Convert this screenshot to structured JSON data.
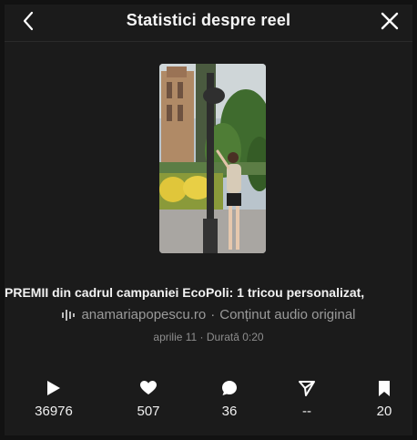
{
  "header": {
    "title": "Statistici despre reel",
    "back_icon": "chevron-left-icon",
    "close_icon": "close-icon"
  },
  "reel": {
    "caption": "PREMII din cadrul campaniei EcoPoli: 1 tricou personalizat,",
    "audio_source": "anamariapopescu.ro",
    "audio_separator": "·",
    "audio_label": "Conținut audio original",
    "meta": "aprilie 11 · Durată 0:20"
  },
  "stats": {
    "plays": "36976",
    "likes": "507",
    "comments": "36",
    "shares": "--",
    "saves": "20"
  },
  "colors": {
    "background": "#1b1b1b",
    "text": "#f5f5f5",
    "muted": "#9a9a9a"
  }
}
